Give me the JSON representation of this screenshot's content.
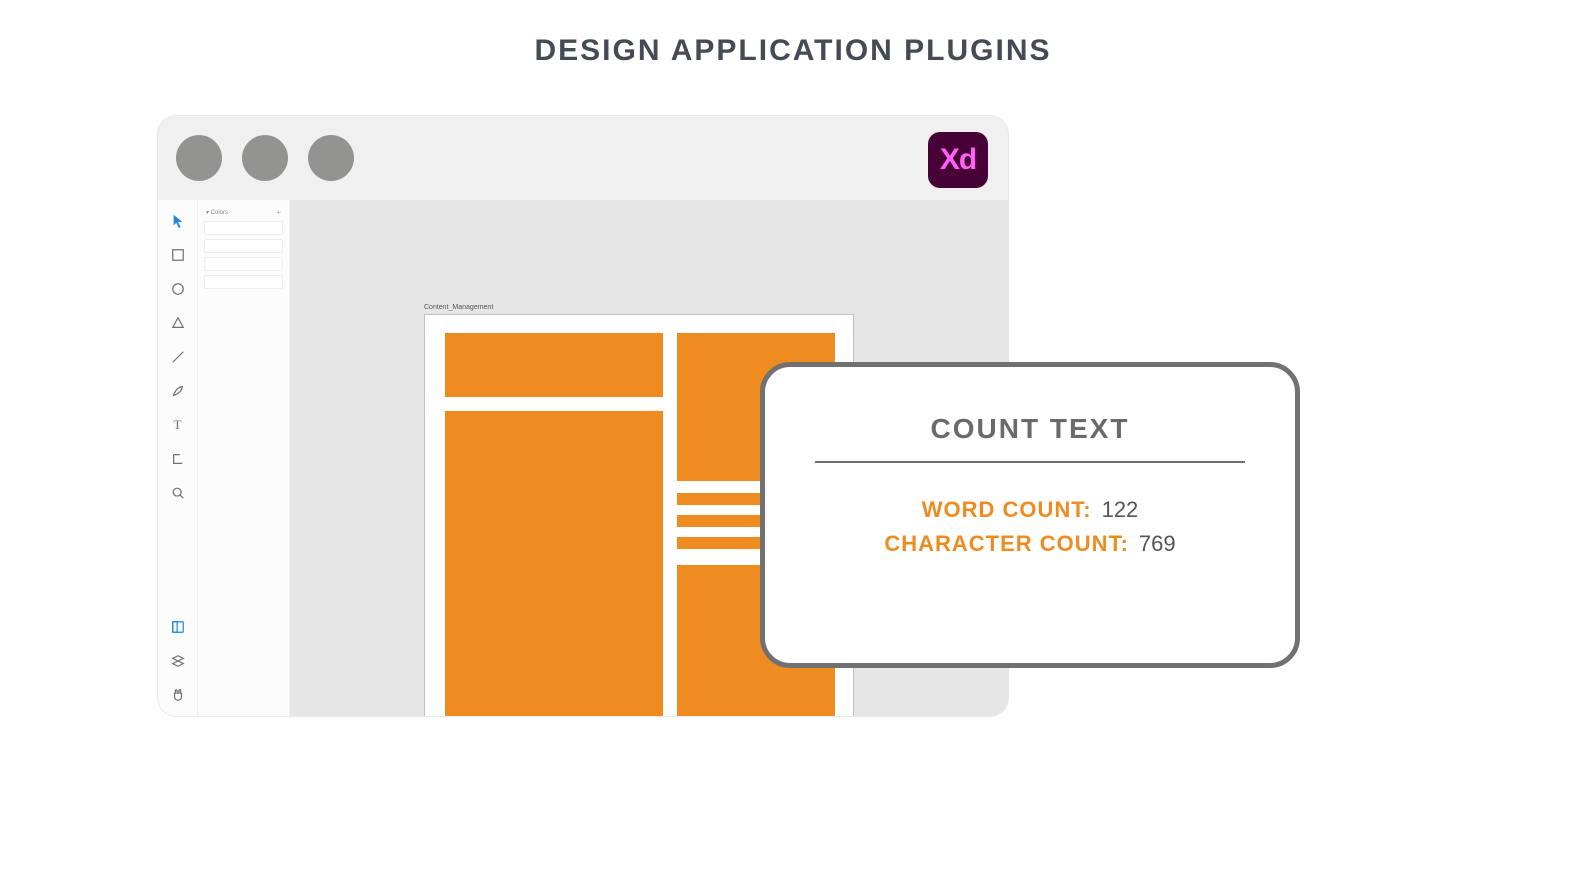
{
  "header": {
    "title": "DESIGN APPLICATION PLUGINS"
  },
  "app": {
    "name": "Xd",
    "panel": {
      "header": "▾ Colors"
    },
    "artboard": {
      "label": "Content_Management"
    }
  },
  "popup": {
    "title": "COUNT TEXT",
    "rows": [
      {
        "label": "WORD COUNT:",
        "value": "122"
      },
      {
        "label": "CHARACTER COUNT:",
        "value": "769"
      }
    ]
  },
  "colors": {
    "accent": "#ee8c22",
    "text_muted": "#6a6a6a",
    "popup_border": "#717171"
  }
}
